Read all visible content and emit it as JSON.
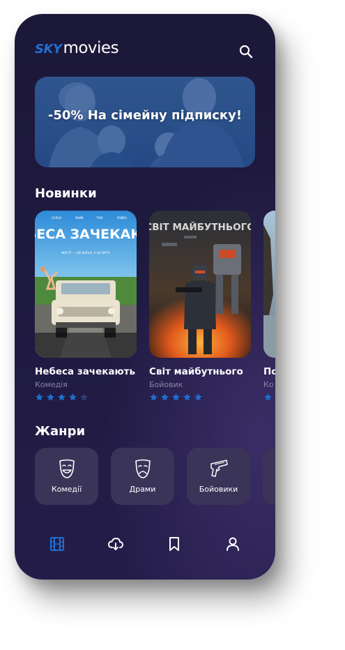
{
  "header": {
    "logo_sky": "SKY",
    "logo_movies": "movies"
  },
  "banner": {
    "text": "-50% На сімейну підписку!"
  },
  "new_section": {
    "title": "Новинки",
    "movies": [
      {
        "title": "Небеса зачекають",
        "genre": "Комедія",
        "rating": 4,
        "poster_title": "НЕБЕСА ЗАЧЕКАЮТЬ",
        "poster_tagline": "МАСТІ — ЦЕ ВІЛЬЯ, А НЕ МІТА"
      },
      {
        "title": "Світ майбутнього",
        "genre": "Бойовик",
        "rating": 5,
        "poster_title": "СВІТ МАЙБУТНЬОГО"
      },
      {
        "title": "По",
        "genre": "Ко",
        "rating": 1
      }
    ]
  },
  "genres_section": {
    "title": "Жанри",
    "items": [
      {
        "label": "Комедії",
        "icon": "comedy-mask-icon"
      },
      {
        "label": "Драми",
        "icon": "drama-mask-icon"
      },
      {
        "label": "Бойовики",
        "icon": "pistol-icon"
      }
    ]
  },
  "bottom_nav": [
    {
      "icon": "film-icon",
      "active": true
    },
    {
      "icon": "cloud-download-icon",
      "active": false
    },
    {
      "icon": "bookmark-icon",
      "active": false
    },
    {
      "icon": "profile-icon",
      "active": false
    }
  ],
  "colors": {
    "accent": "#1f6fd1",
    "background": "#1e1a3e",
    "card": "#3a3459",
    "muted": "#8a86a6"
  }
}
